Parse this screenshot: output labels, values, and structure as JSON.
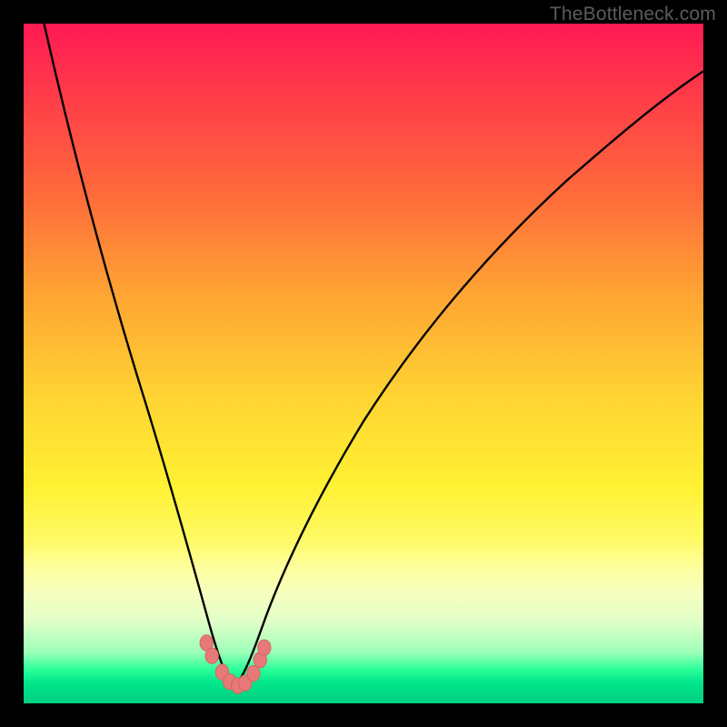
{
  "watermark": "TheBottleneck.com",
  "colors": {
    "frame_bg": "#000000",
    "curve_stroke": "#000000",
    "marker_fill": "#e77a78",
    "marker_stroke": "#d56866"
  },
  "chart_data": {
    "type": "line",
    "title": "",
    "xlabel": "",
    "ylabel": "",
    "xlim": [
      0,
      100
    ],
    "ylim": [
      0,
      100
    ],
    "grid": false,
    "legend": false,
    "note": "V-shaped bottleneck curve with minimum near x≈31; values are visual estimates (no axis labels present).",
    "series": [
      {
        "name": "bottleneck_curve",
        "x": [
          3,
          5,
          8,
          11,
          14,
          17,
          20,
          23,
          25.5,
          27.5,
          29,
          30,
          31,
          32,
          33.5,
          35.5,
          38,
          42,
          48,
          55,
          63,
          72,
          82,
          92,
          100
        ],
        "values": [
          100,
          90,
          78,
          66,
          54,
          42,
          31,
          21,
          13,
          8,
          4.5,
          2.7,
          2.2,
          2.7,
          4.5,
          8,
          13.5,
          22,
          32,
          42,
          52,
          62,
          72,
          81,
          87
        ]
      }
    ],
    "markers": {
      "name": "highlight_dots",
      "x": [
        26.9,
        27.7,
        29.2,
        30.3,
        31.5,
        32.6,
        33.8,
        34.8,
        35.4
      ],
      "values": [
        8.9,
        7.0,
        4.6,
        3.2,
        2.6,
        3.0,
        4.4,
        6.4,
        8.2
      ]
    }
  }
}
